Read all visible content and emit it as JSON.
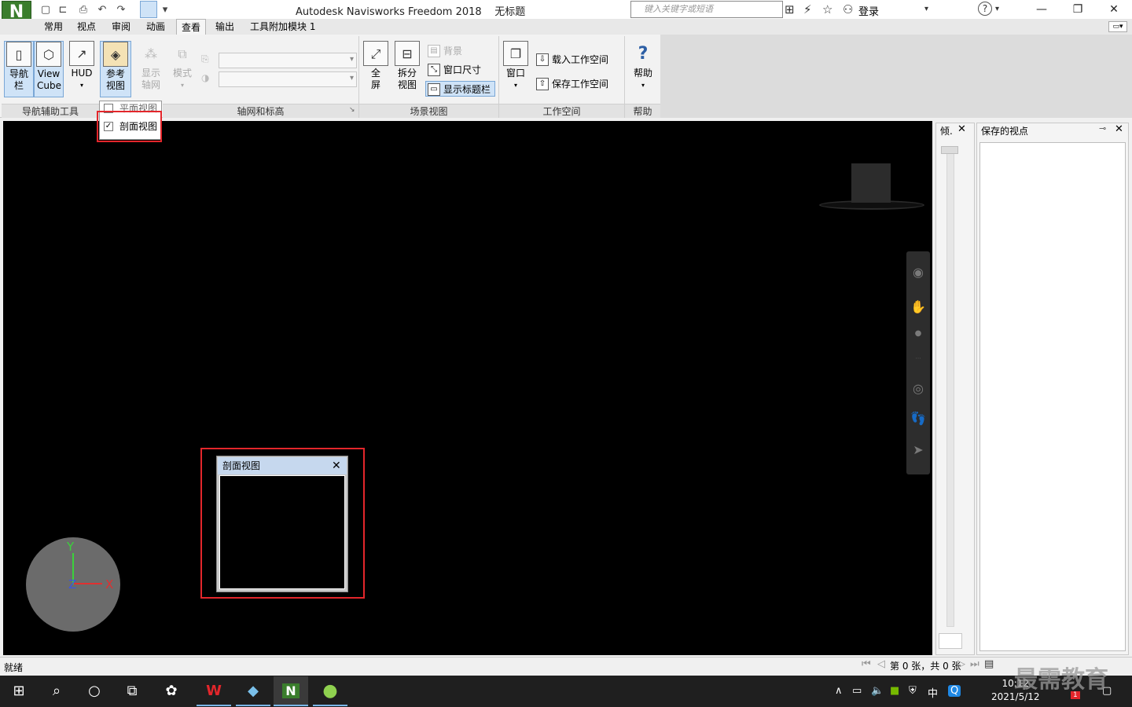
{
  "title_bar": {
    "app_title": "Autodesk Navisworks Freedom 2018",
    "doc_title": "无标题",
    "search_placeholder": "键入关键字或短语",
    "login": "登录",
    "help": "?"
  },
  "tabs": [
    {
      "label": "常用"
    },
    {
      "label": "视点"
    },
    {
      "label": "审阅"
    },
    {
      "label": "动画"
    },
    {
      "label": "查看",
      "active": true
    },
    {
      "label": "输出"
    },
    {
      "label": "工具附加模块 1"
    }
  ],
  "ribbon": {
    "nav_bar_btn": "导航栏",
    "viewcube_btn": "View Cube",
    "hud_btn": "HUD",
    "ref_view_btn": "参考视图",
    "show_grid_btn": "显示轴网",
    "mode_btn": "模式",
    "background_btn": "背景",
    "window_size_btn": "窗口尺寸",
    "show_titlebar_btn": "显示标题栏",
    "fullscreen_btn": "全屏",
    "split_view_btn": "拆分视图",
    "window_btn": "窗口",
    "load_workspace_btn": "载入工作空间",
    "save_workspace_btn": "保存工作空间",
    "help_btn": "帮助",
    "panels": {
      "nav_aids": "导航辅助工具",
      "grids": "轴网和标高",
      "scene_view": "场景视图",
      "workspace": "工作空间",
      "help": "帮助"
    }
  },
  "dropdown": {
    "plan_view": "平面视图",
    "section_view": "剖面视图"
  },
  "section_window": {
    "title": "剖面视图"
  },
  "axes": {
    "y": "Y",
    "z": "Z",
    "x": "X"
  },
  "tilt_panel": {
    "title": "倾."
  },
  "saved_views_panel": {
    "title": "保存的视点"
  },
  "status": {
    "text": "就绪",
    "sheet_info": "第 0 张，共 0 张"
  },
  "taskbar": {
    "time": "10:12",
    "date": "2021/5/12",
    "ime": "中",
    "notification_count": "1"
  },
  "watermark": "最需教育"
}
